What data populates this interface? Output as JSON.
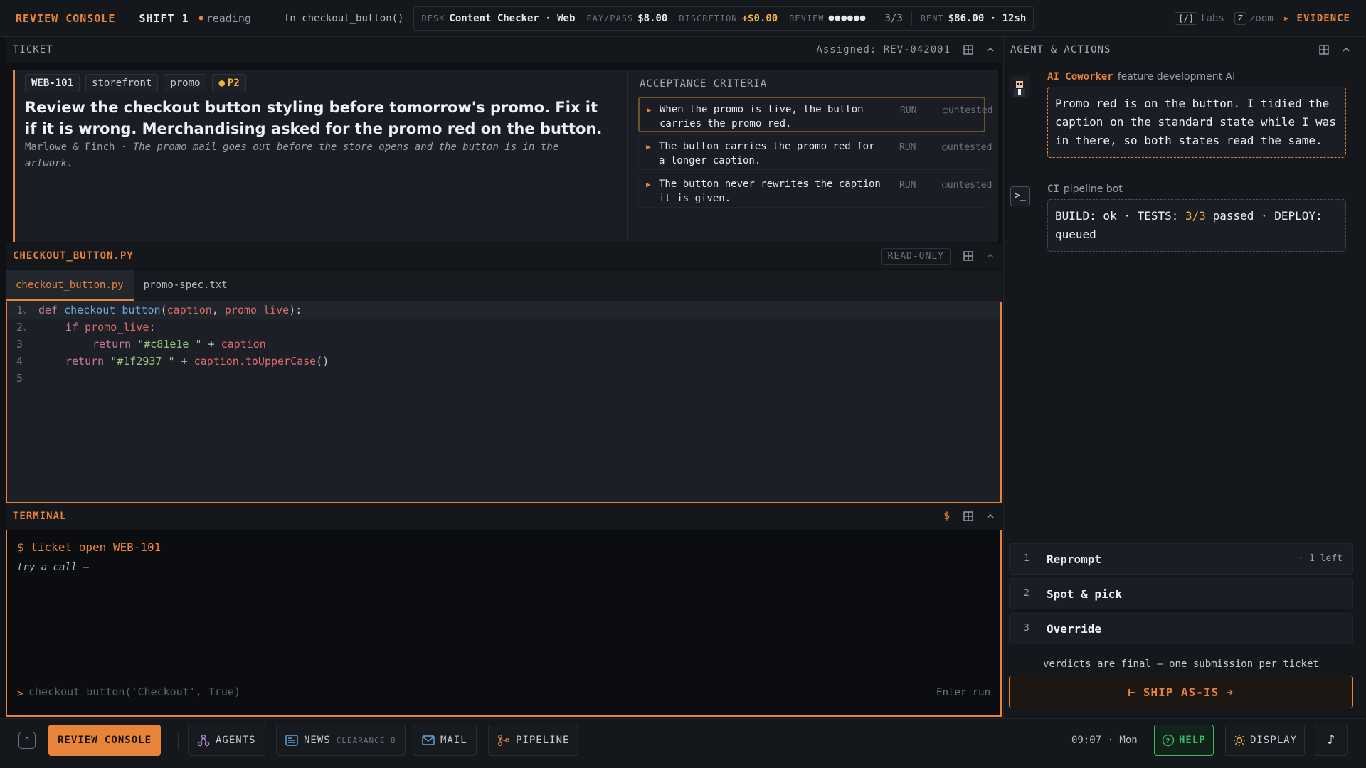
{
  "topbar": {
    "brand": "REVIEW CONSOLE",
    "shift": "SHIFT 1",
    "status": "reading",
    "fn": "fn checkout_button()",
    "desk_label": "DESK",
    "desk_value": "Content Checker · Web",
    "pay_label": "PAY/PASS",
    "pay_value": "$8.00",
    "discretion_label": "DISCRETION",
    "discretion_value": "+$0.00",
    "review_label": "REVIEW",
    "review_dots": "●●●●●●",
    "review_frac": "3/3",
    "rent_label": "RENT",
    "rent_value": "$86.00 · 12sh",
    "tabs_key": "[/]",
    "tabs_label": "tabs",
    "zoom_key": "Z",
    "zoom_label": "zoom",
    "evidence": "▸ EVIDENCE"
  },
  "ticket": {
    "header": "TICKET",
    "assigned": "Assigned: REV-042001",
    "tags": [
      "WEB-101",
      "storefront",
      "promo"
    ],
    "priority": "P2",
    "title": "Review the checkout button styling before tomorrow's promo. Fix it if it is wrong. Merchandising asked for the promo red on the button.",
    "meta_author": "Marlowe & Finch · ",
    "meta_note": "The promo mail goes out before the store opens and the button is in the artwork.",
    "criteria_title": "ACCEPTANCE CRITERIA",
    "criteria": [
      {
        "text": "When the promo is live, the button carries the promo red.",
        "run": "RUN",
        "status": "○untested"
      },
      {
        "text": "The button carries the promo red for a longer caption.",
        "run": "RUN",
        "status": "○untested"
      },
      {
        "text": "The button never rewrites the caption it is given.",
        "run": "RUN",
        "status": "○untested"
      }
    ]
  },
  "editor": {
    "header": "CHECKOUT_BUTTON.PY",
    "readonly": "READ-ONLY",
    "tabs": [
      "checkout_button.py",
      "promo-spec.txt"
    ],
    "line_numbers": [
      "1",
      "2",
      "3",
      "4",
      "5"
    ],
    "lines": {
      "l1_kw": "def ",
      "l1_fn": "checkout_button",
      "l1_open": "(",
      "l1_p1": "caption",
      "l1_comma": ", ",
      "l1_p2": "promo_live",
      "l1_close": "):",
      "l2_kw": "if ",
      "l2_p": "promo_live",
      "l2_colon": ":",
      "l3_kw": "return ",
      "l3_str": "\"#c81e1e \"",
      "l3_op": " + ",
      "l3_p": "caption",
      "l4_kw": "return ",
      "l4_str": "\"#1f2937 \"",
      "l4_op": " + ",
      "l4_p": "caption.toUpperCase",
      "l4_end": "()"
    }
  },
  "terminal": {
    "header": "TERMINAL",
    "dollar": "$",
    "command": "$ ticket open WEB-101",
    "hint": "try a call —",
    "prompt": ">",
    "placeholder": "checkout_button('Checkout', True)",
    "enter_run": "Enter run"
  },
  "agent": {
    "header": "AGENT & ACTIONS",
    "coworker_name": "AI Coworker",
    "coworker_role": "feature development AI",
    "coworker_msg": "Promo red is on the button. I tidied the caption on the standard state while I was in there, so both states read the same.",
    "ci_name": "CI",
    "ci_role": "pipeline bot",
    "ci_icon": ">_",
    "ci_msg_a": "BUILD: ok · TESTS: ",
    "ci_msg_b": "3/3",
    "ci_msg_c": " passed · DEPLOY: queued",
    "actions": [
      {
        "num": "1",
        "label": "Reprompt",
        "note": "· 1 left"
      },
      {
        "num": "2",
        "label": "Spot & pick",
        "note": ""
      },
      {
        "num": "3",
        "label": "Override",
        "note": ""
      }
    ],
    "verdict_note": "verdicts are final — one submission per ticket",
    "ship_label": "⊢ SHIP AS-IS ➔"
  },
  "taskbar": {
    "review": "REVIEW CONSOLE",
    "agents": "AGENTS",
    "news": "NEWS",
    "news_sub": "CLEARANCE 8",
    "mail": "MAIL",
    "pipeline": "PIPELINE",
    "clock": "09:07 · Mon",
    "help": "HELP",
    "display": "DISPLAY",
    "music": "♪"
  },
  "colors": {
    "accent": "#e8833a",
    "gold": "#f3b33e",
    "help_green": "#3fb56a",
    "background": "#0f1114"
  }
}
